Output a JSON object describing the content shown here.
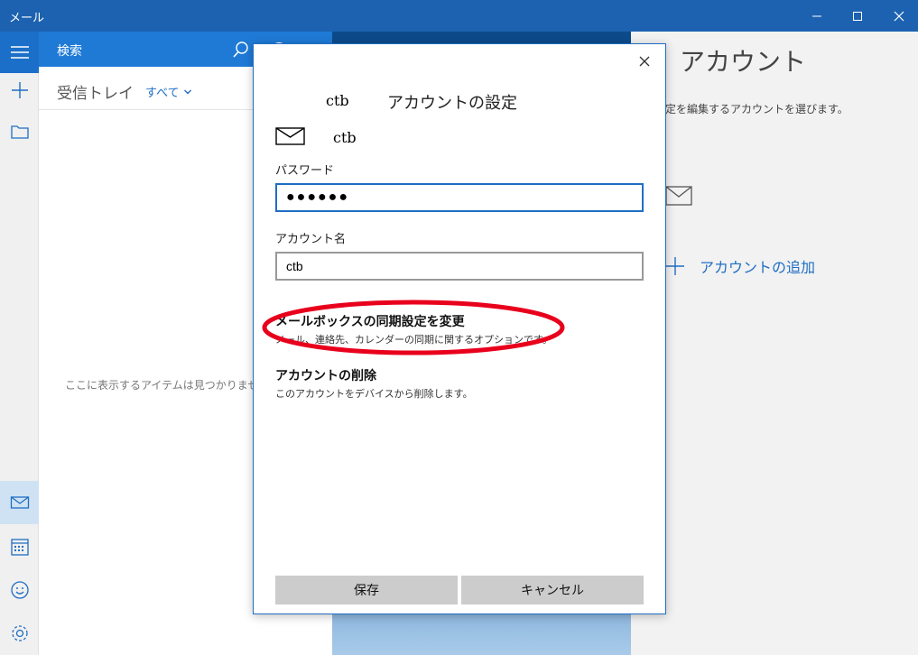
{
  "window": {
    "title": "メール"
  },
  "search": {
    "label": "検索"
  },
  "inbox": {
    "title": "受信トレイ",
    "filter": "すべて",
    "empty_message": "ここに表示するアイテムは見つかりません。"
  },
  "accounts_panel": {
    "title": "アカウント",
    "subtitle": "設定を編集するアカウントを選びます。",
    "add_account": "アカウントの追加"
  },
  "dialog": {
    "header_name": "ctb",
    "title": "アカウントの設定",
    "email": "ctb",
    "password_label": "パスワード",
    "password_value": "●●●●●●",
    "account_name_label": "アカウント名",
    "account_name_value": "ctb",
    "sync_option": {
      "title": "メールボックスの同期設定を変更",
      "description": "メール、連絡先、カレンダーの同期に関するオプションです。"
    },
    "delete_option": {
      "title": "アカウントの削除",
      "description": "このアカウントをデバイスから削除します。"
    },
    "save_button": "保存",
    "cancel_button": "キャンセル"
  },
  "colors": {
    "titlebar": "#1c62b0",
    "accent": "#1f7ad6",
    "highlight_ellipse": "#e8001c"
  }
}
